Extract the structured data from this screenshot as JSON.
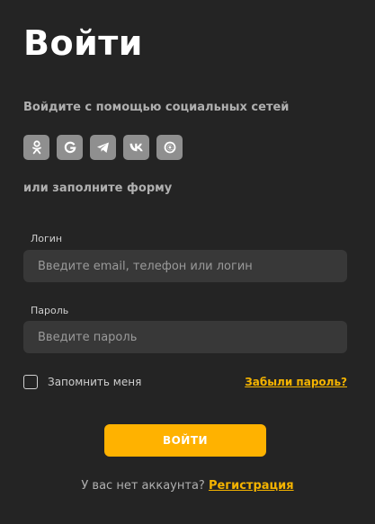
{
  "title": "Войти",
  "social": {
    "caption": "Войдите с помощью социальных сетей",
    "icons": [
      "odnoklassniki-icon",
      "google-icon",
      "telegram-icon",
      "vk-icon",
      "mailru-icon"
    ]
  },
  "form_caption": "или заполните форму",
  "login": {
    "label": "Логин",
    "placeholder": "Введите email, телефон или логин",
    "value": ""
  },
  "password": {
    "label": "Пароль",
    "placeholder": "Введите пароль",
    "value": ""
  },
  "remember": {
    "label": "Запомнить меня",
    "checked": false
  },
  "forgot_link": "Забыли пароль?",
  "submit_label": "ВОЙТИ",
  "footer": {
    "text": "У вас нет аккаунта?",
    "link": "Регистрация"
  },
  "colors": {
    "background": "#242424",
    "accent": "#ffb200",
    "link": "#f5b400",
    "input_bg": "#383838",
    "social_bg": "#8f8f8f"
  }
}
